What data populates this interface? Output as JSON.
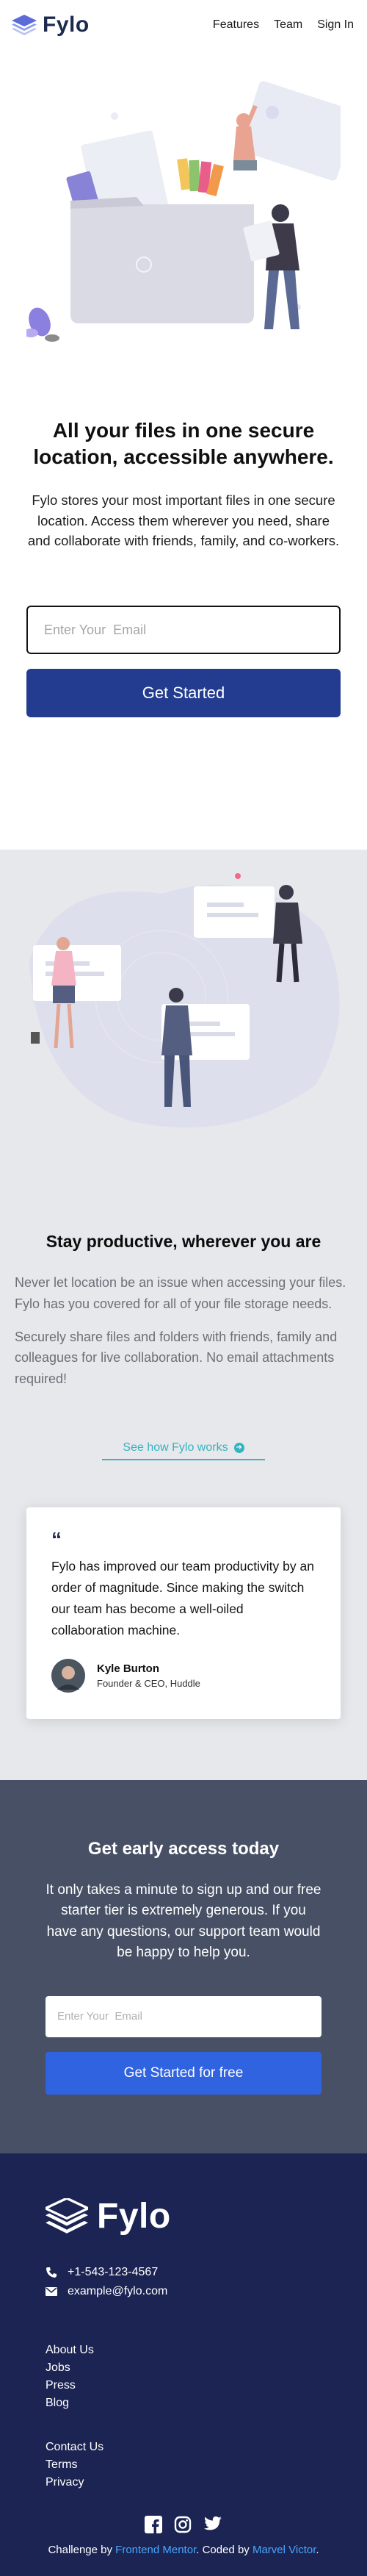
{
  "header": {
    "logo_text": "Fylo",
    "nav": [
      "Features",
      "Team",
      "Sign In"
    ]
  },
  "hero": {
    "title": "All your files in one secure location, accessible anywhere.",
    "text": "Fylo stores your most important files in one secure location. Access them wherever you need, share and collaborate with friends, family, and co-workers.",
    "email_placeholder": "Enter Your  Email",
    "cta_label": "Get Started"
  },
  "productive": {
    "title": "Stay productive, wherever you are",
    "paragraphs": [
      "Never let location be an issue when accessing your files. Fylo has you covered for all of your file storage needs.",
      "Securely share files and folders with friends, family and colleagues for live collaboration. No email attachments required!"
    ],
    "link_label": "See how Fylo works",
    "testimonial": {
      "quote_mark": "“",
      "quote": "Fylo has improved our team productivity by an order of magnitude. Since making the switch our team has become a well-oiled collaboration machine.",
      "name": "Kyle Burton",
      "role": "Founder & CEO, Huddle"
    }
  },
  "early_access": {
    "title": "Get early access today",
    "text": "It only takes a minute to sign up and our free starter tier is extremely generous. If you have any questions, our support team would be happy to help you.",
    "email_placeholder": "Enter Your  Email",
    "button_label": "Get Started for free"
  },
  "footer": {
    "logo_text": "Fylo",
    "phone": "+1-543-123-4567",
    "email": "example@fylo.com",
    "links_col1": [
      "About Us",
      "Jobs",
      "Press",
      "Blog"
    ],
    "links_col2": [
      "Contact Us",
      "Terms",
      "Privacy"
    ],
    "socials": [
      "facebook-icon",
      "instagram-icon",
      "twitter-icon"
    ],
    "credit_prefix": "Challenge by",
    "credit_challenge": "Frontend Mentor",
    "credit_mid": ". Coded by",
    "credit_author": "Marvel Victor",
    "credit_suffix": "."
  },
  "colors": {
    "brand_navy": "#1b2452",
    "cta_blue": "#233c8f",
    "accent_teal": "#33b4bf",
    "early_bg": "#475064",
    "early_button": "#3063e0",
    "productive_bg": "#e7e8ec"
  }
}
